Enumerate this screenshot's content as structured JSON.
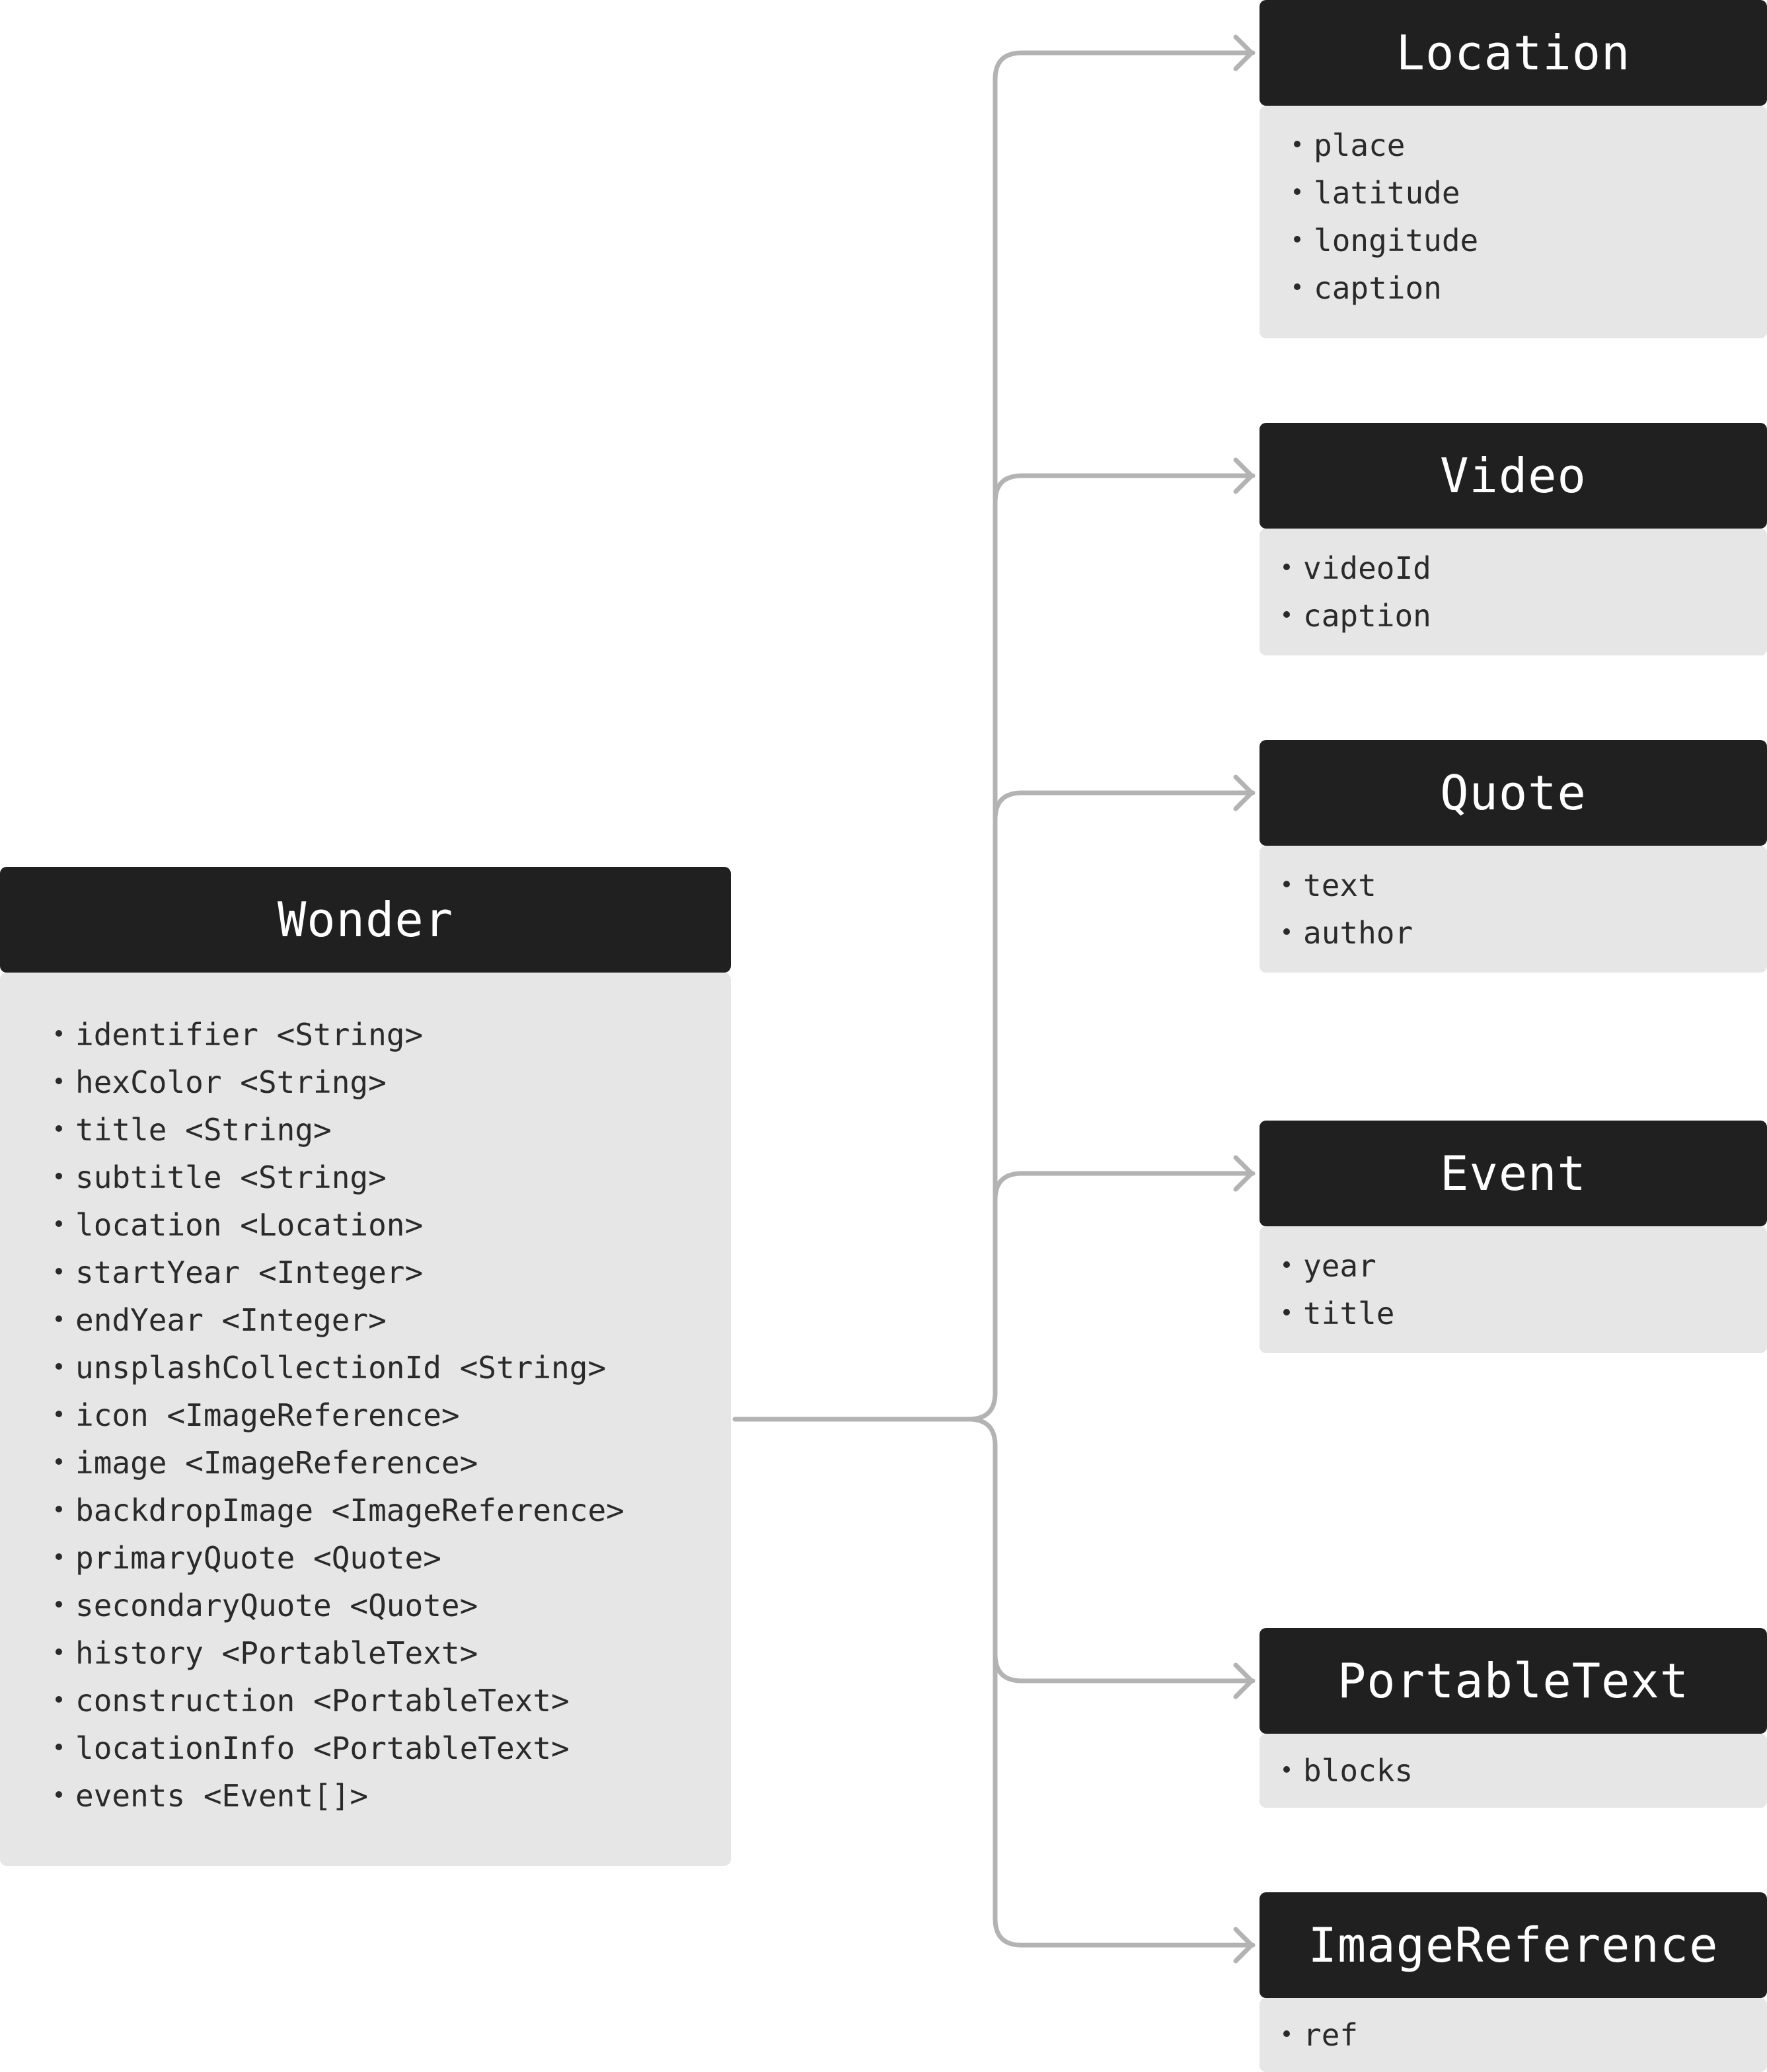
{
  "diagram": {
    "root": {
      "name": "Wonder",
      "fields": [
        "identifier <String>",
        "hexColor <String>",
        "title <String>",
        "subtitle <String>",
        "location <Location>",
        "startYear <Integer>",
        "endYear <Integer>",
        "unsplashCollectionId <String>",
        "icon <ImageReference>",
        "image <ImageReference>",
        "backdropImage <ImageReference>",
        "primaryQuote <Quote>",
        "secondaryQuote <Quote>",
        "history <PortableText>",
        "construction <PortableText>",
        "locationInfo <PortableText>",
        "events <Event[]>"
      ]
    },
    "types": [
      {
        "name": "Location",
        "fields": [
          "place",
          "latitude",
          "longitude",
          "caption"
        ]
      },
      {
        "name": "Video",
        "fields": [
          "videoId",
          "caption"
        ]
      },
      {
        "name": "Quote",
        "fields": [
          "text",
          "author"
        ]
      },
      {
        "name": "Event",
        "fields": [
          "year",
          "title"
        ]
      },
      {
        "name": "PortableText",
        "fields": [
          "blocks"
        ]
      },
      {
        "name": "ImageReference",
        "fields": [
          "ref"
        ]
      }
    ],
    "colors": {
      "header_bg": "#202020",
      "header_text": "#ffffff",
      "body_bg": "#e6e6e6",
      "body_text": "#2a2a2a",
      "connector": "#b3b3b3"
    }
  }
}
